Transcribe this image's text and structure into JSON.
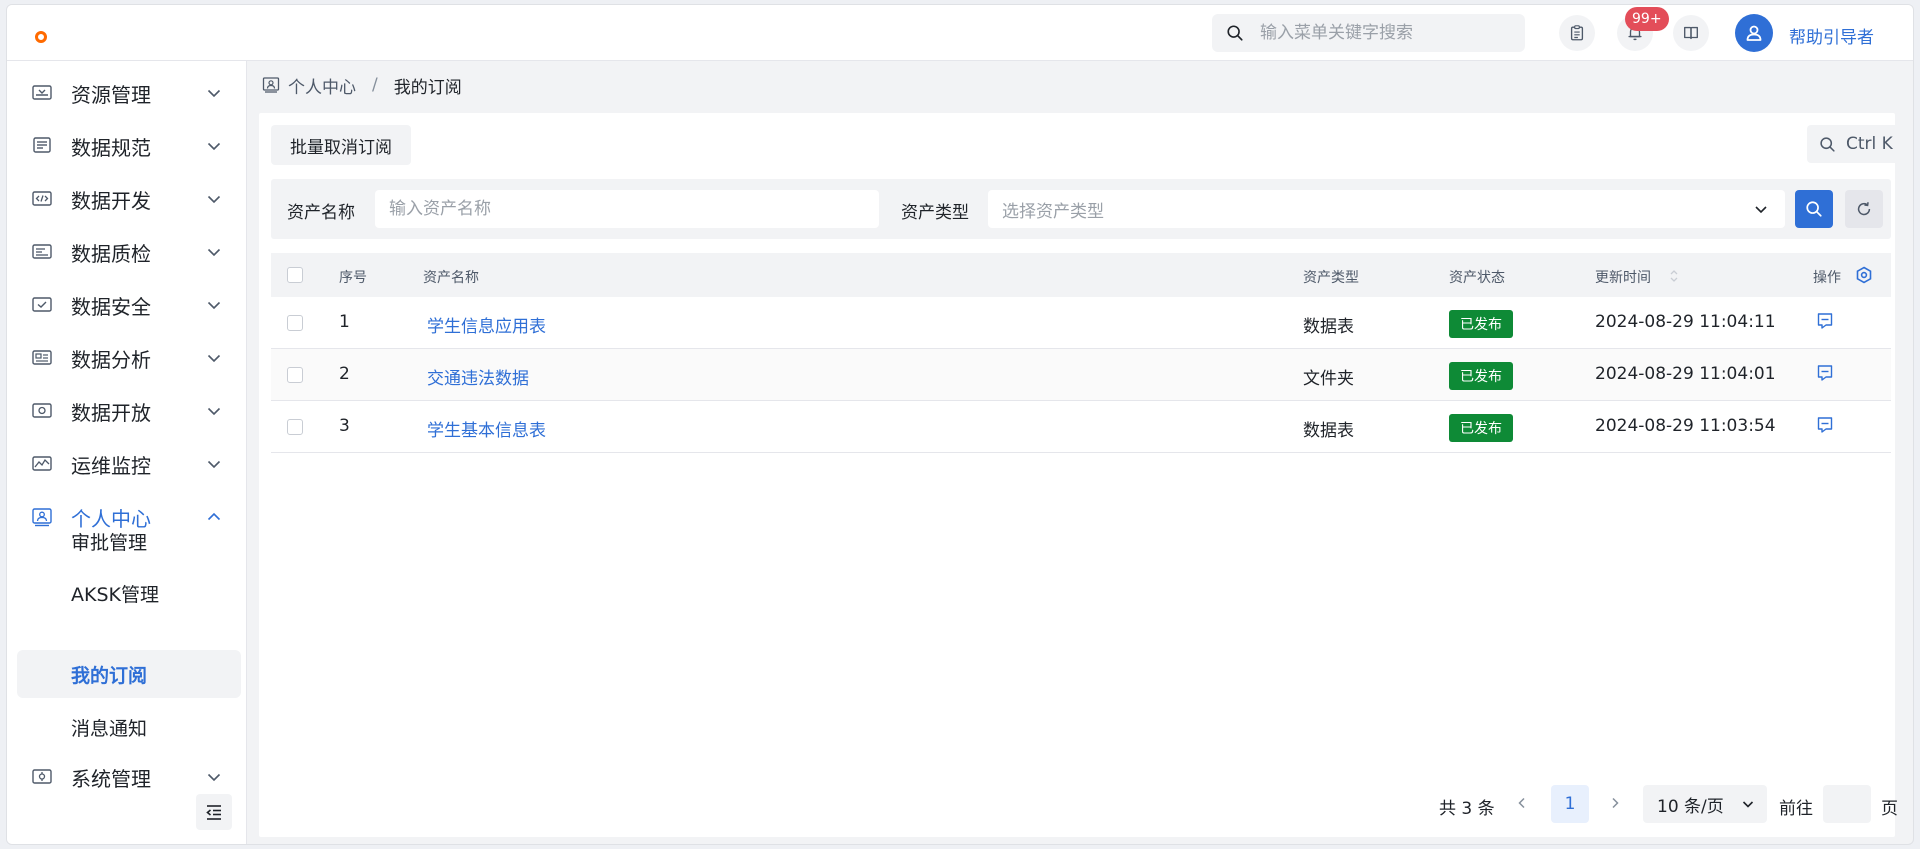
{
  "header": {
    "search_placeholder": "输入菜单关键字搜索",
    "notification_count": "99+",
    "username": "帮助引导者"
  },
  "sidebar": {
    "items": [
      {
        "label": "资源管理",
        "icon": "resource-icon"
      },
      {
        "label": "数据规范",
        "icon": "standard-icon"
      },
      {
        "label": "数据开发",
        "icon": "code-icon"
      },
      {
        "label": "数据质检",
        "icon": "quality-icon"
      },
      {
        "label": "数据安全",
        "icon": "security-icon"
      },
      {
        "label": "数据分析",
        "icon": "analysis-icon"
      },
      {
        "label": "数据开放",
        "icon": "open-icon"
      },
      {
        "label": "运维监控",
        "icon": "monitor-icon"
      },
      {
        "label": "个人中心",
        "icon": "personal-icon"
      },
      {
        "label": "系统管理",
        "icon": "system-icon"
      }
    ],
    "subitems": [
      {
        "label": "审批管理"
      },
      {
        "label": "AKSK管理"
      },
      {
        "label": "我的订阅"
      },
      {
        "label": "消息通知"
      }
    ]
  },
  "breadcrumb": {
    "parent": "个人中心",
    "separator": "/",
    "current": "我的订阅"
  },
  "toolbar": {
    "batch_unsubscribe": "批量取消订阅",
    "shortcut": "Ctrl K"
  },
  "filter": {
    "asset_name_label": "资产名称",
    "asset_name_placeholder": "输入资产名称",
    "asset_type_label": "资产类型",
    "asset_type_placeholder": "选择资产类型"
  },
  "table": {
    "columns": {
      "index": "序号",
      "name": "资产名称",
      "type": "资产类型",
      "status": "资产状态",
      "updated": "更新时间",
      "actions": "操作"
    },
    "rows": [
      {
        "index": "1",
        "name": "学生信息应用表",
        "type": "数据表",
        "status": "已发布",
        "updated": "2024-08-29 11:04:11"
      },
      {
        "index": "2",
        "name": "交通违法数据",
        "type": "文件夹",
        "status": "已发布",
        "updated": "2024-08-29 11:04:01"
      },
      {
        "index": "3",
        "name": "学生基本信息表",
        "type": "数据表",
        "status": "已发布",
        "updated": "2024-08-29 11:03:54"
      }
    ]
  },
  "pagination": {
    "total": "共 3 条",
    "current_page": "1",
    "page_size": "10 条/页",
    "goto_label": "前往",
    "page_suffix": "页"
  },
  "colors": {
    "primary": "#2f6fd6",
    "success": "#0e8a36",
    "badge": "#e34d59",
    "logo": "#ff6a00"
  }
}
